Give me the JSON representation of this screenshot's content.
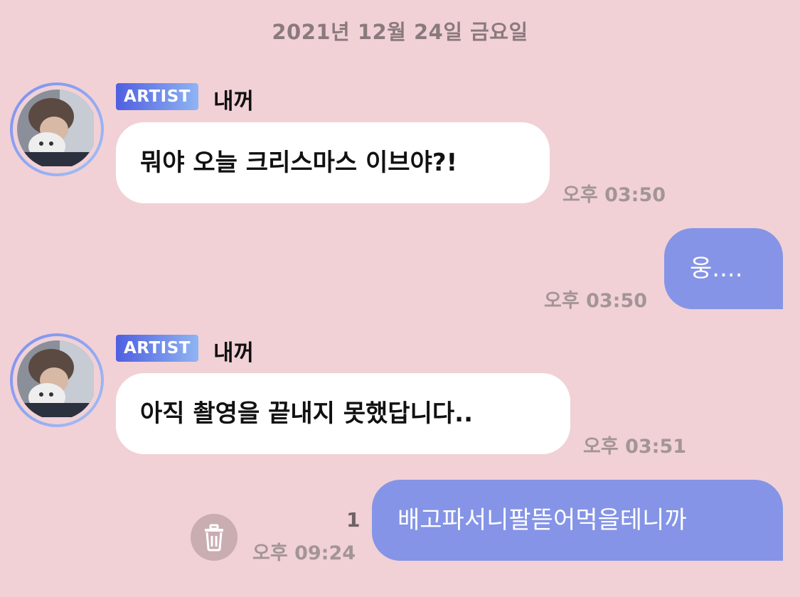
{
  "date_header": "2021년 12월 24일 금요일",
  "messages": [
    {
      "direction": "incoming",
      "badge": "ARTIST",
      "sender": "내꺼",
      "text": "뭐야 오늘 크리스마스 이브야?!",
      "time": "오후 03:50",
      "icon": "avatar-photo"
    },
    {
      "direction": "outgoing",
      "text": "웅....",
      "time": "오후 03:50"
    },
    {
      "direction": "incoming",
      "badge": "ARTIST",
      "sender": "내꺼",
      "text": "아직 촬영을 끝내지 못했답니다..",
      "time": "오후 03:51",
      "icon": "avatar-photo"
    },
    {
      "direction": "outgoing",
      "text": "배고파서니팔뜯어먹을테니까",
      "time": "오후 09:24",
      "unread_count": "1",
      "action_icon": "trash-icon"
    }
  ],
  "colors": {
    "background": "#f1d1d6",
    "incoming_bubble": "#ffffff",
    "outgoing_bubble": "#8594e6",
    "badge_gradient_start": "#4f5fe0",
    "badge_gradient_end": "#8fb4f2",
    "timestamp": "#a39597"
  }
}
